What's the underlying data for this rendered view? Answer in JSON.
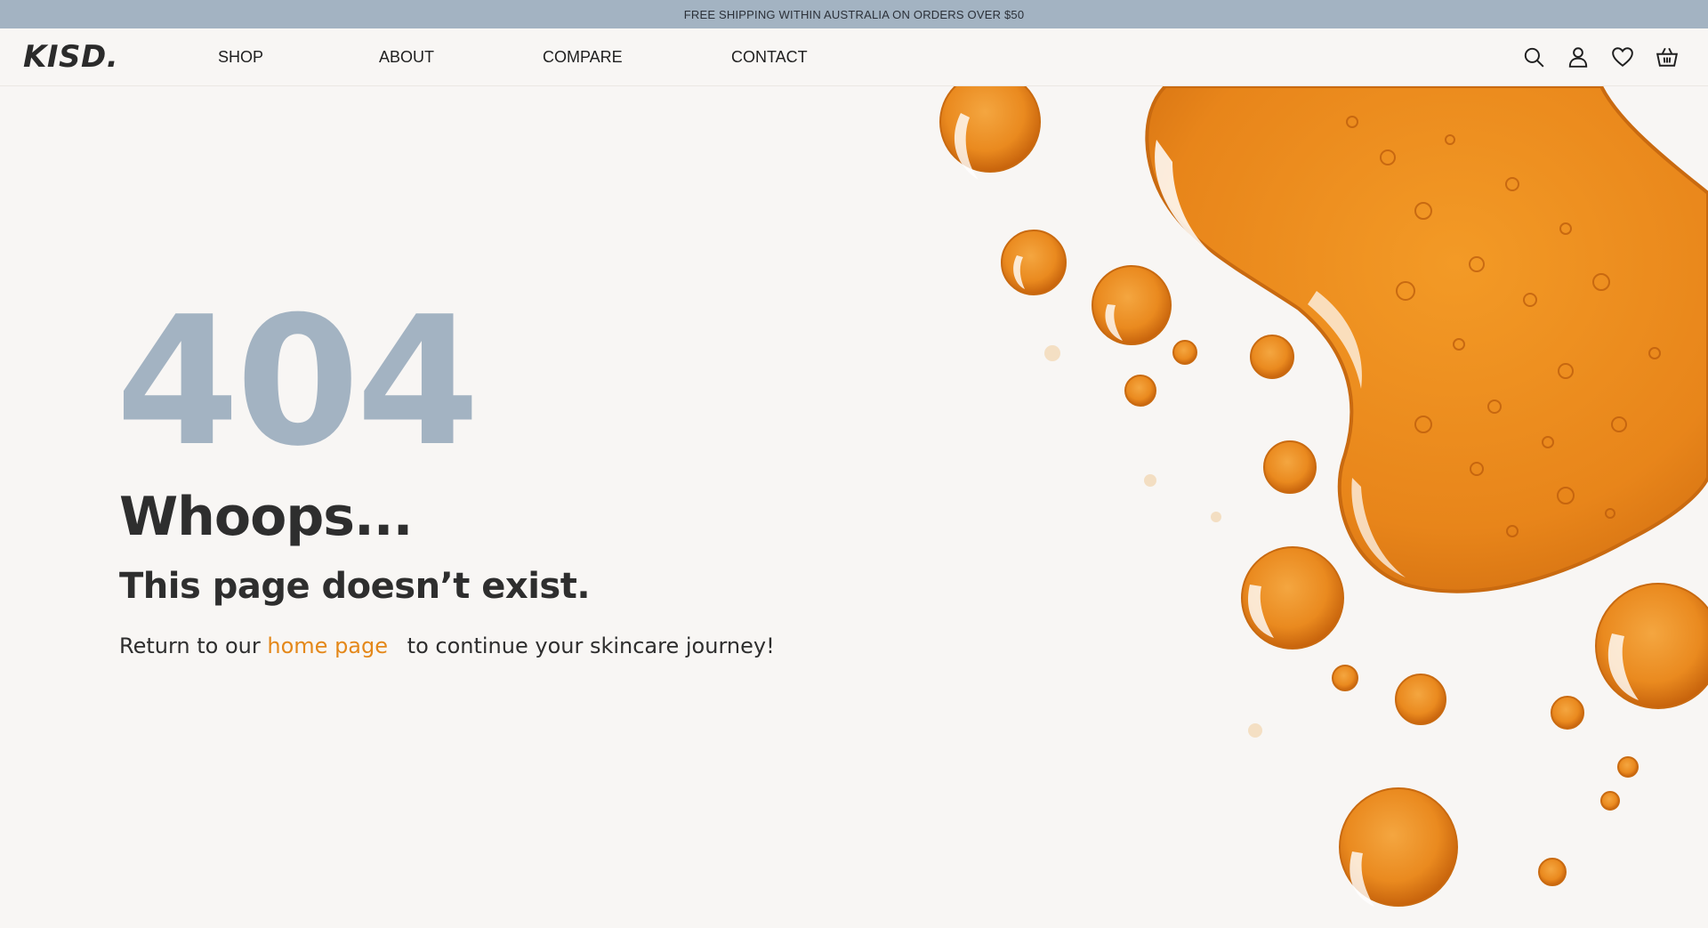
{
  "announcement": {
    "text": "FREE SHIPPING WITHIN AUSTRALIA ON ORDERS OVER $50"
  },
  "header": {
    "logo": "KISD.",
    "nav": [
      {
        "label": "SHOP"
      },
      {
        "label": "ABOUT"
      },
      {
        "label": "COMPARE"
      },
      {
        "label": "CONTACT"
      }
    ],
    "icons": [
      "search-icon",
      "account-icon",
      "wishlist-heart-icon",
      "cart-basket-icon"
    ]
  },
  "error": {
    "code": "404",
    "heading": "Whoops...",
    "subheading": "This page doesn’t exist.",
    "message_before": "Return to our",
    "link_label": "home page",
    "message_after": "to continue your skincare journey!"
  },
  "colors": {
    "announcement_bg": "#a3b3c2",
    "code_color": "#a3b3c2",
    "link_color": "#e4881a",
    "page_bg": "#f8f6f4"
  }
}
